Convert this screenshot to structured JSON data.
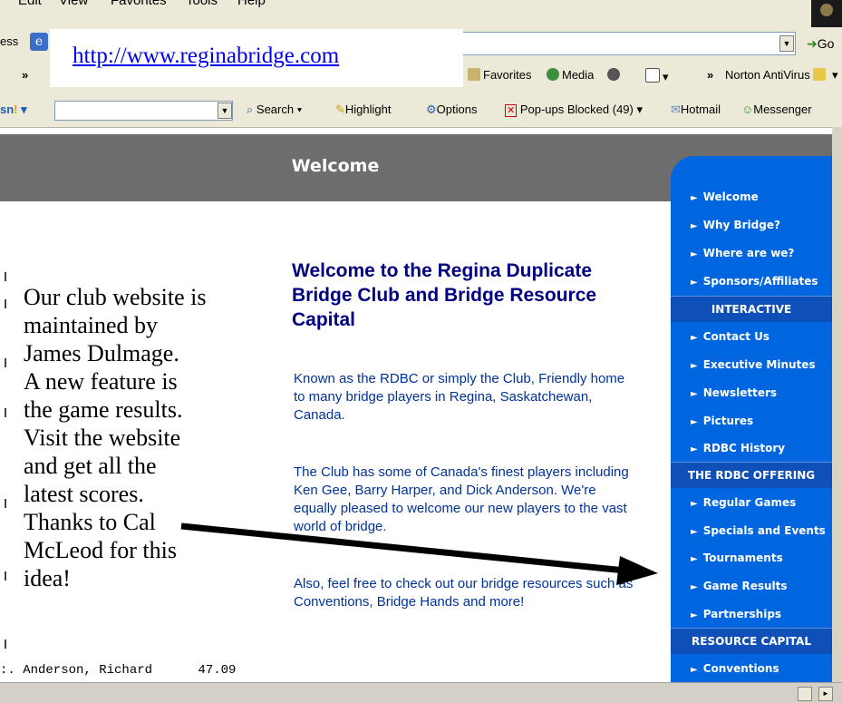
{
  "browser": {
    "menu": [
      "Edit",
      "View",
      "Favorites",
      "Tools",
      "Help"
    ],
    "address_label": "ess",
    "go_label": "Go",
    "links_bar": {
      "chevron": "»",
      "favorites": "Favorites",
      "media": "Media",
      "chevron2": "»",
      "norton": "Norton AntiVirus"
    },
    "msn_bar": {
      "search": "Search",
      "highlight": "Highlight",
      "options": "Options",
      "popups": "Pop-ups Blocked (49)",
      "hotmail": "Hotmail",
      "messenger": "Messenger"
    }
  },
  "url_overlay": "http://www.reginabridge.com",
  "page": {
    "header_title": "Welcome",
    "heading": "Welcome to the Regina Duplicate Bridge Club and Bridge Resource Capital",
    "paragraphs": [
      "Known as the RDBC or simply the Club, Friendly home to many bridge players in Regina, Saskatchewan, Canada.",
      "The Club has some of Canada's finest players including Ken Gee, Barry Harper, and Dick Anderson. We're equally pleased to welcome our new players to the vast world of bridge.",
      "Also, feel free to check out our bridge resources such as Conventions, Bridge Hands and more!"
    ],
    "score_line": ":. Anderson, Richard      47.09"
  },
  "caption_lines": [
    "Our club website is",
    "maintained by",
    "James Dulmage.",
    "A new feature is",
    "the game results.",
    "Visit the website",
    "and get all the",
    "latest scores.",
    "Thanks to Cal",
    "McLeod for this",
    "idea!"
  ],
  "sidebar": {
    "items_top": [
      "Welcome",
      "Why Bridge?",
      "Where are we?",
      "Sponsors/Affiliates"
    ],
    "section1": "INTERACTIVE",
    "items_interactive": [
      "Contact Us",
      "Executive Minutes",
      "Newsletters",
      "Pictures",
      "RDBC History"
    ],
    "section2": "THE RDBC OFFERING",
    "items_offering": [
      "Regular Games",
      "Specials and Events",
      "Tournaments",
      "Game Results",
      "Partnerships"
    ],
    "section3": "RESOURCE CAPITAL",
    "items_resource": [
      "Conventions"
    ]
  },
  "colors": {
    "sidebar_blue": "#0066e0",
    "sidebar_section": "#0f4fb8",
    "header_gray": "#6d6d6d",
    "heading_navy": "#000080",
    "link_blue": "#0000ee"
  },
  "icons": [
    "ie-icon",
    "favorites-icon",
    "media-icon",
    "search-icon",
    "highlight-icon",
    "options-icon",
    "popup-blocker-icon",
    "hotmail-icon",
    "messenger-icon",
    "norton-icon",
    "arrow-annotation"
  ]
}
